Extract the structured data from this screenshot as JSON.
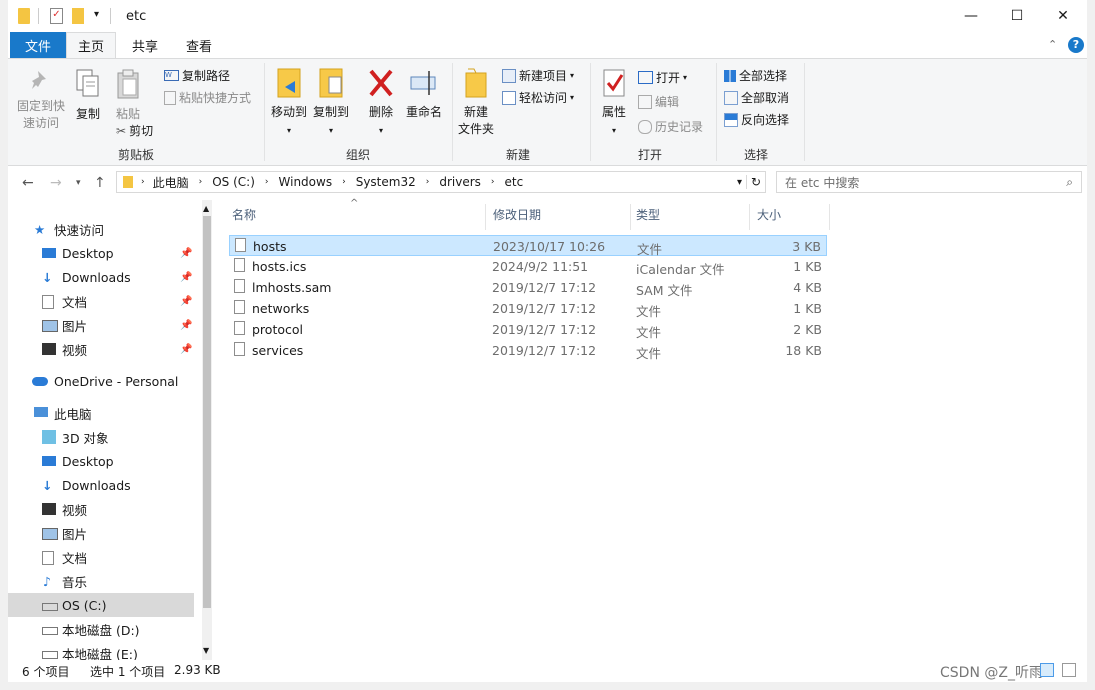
{
  "window": {
    "title": "etc",
    "controls": {
      "minimize": "—",
      "maximize": "☐",
      "close": "✕"
    }
  },
  "ribbon_tabs": [
    "文件",
    "主页",
    "共享",
    "查看"
  ],
  "ribbon": {
    "clipboard": {
      "label": "剪贴板",
      "pin_quick_access": [
        "固定到快",
        "速访问"
      ],
      "copy": "复制",
      "paste": "粘贴",
      "copy_path": "复制路径",
      "paste_shortcut": "粘贴快捷方式",
      "cut": "剪切"
    },
    "organize": {
      "label": "组织",
      "move_to": "移动到",
      "copy_to": "复制到",
      "delete": "删除",
      "rename": "重命名"
    },
    "new": {
      "label": "新建",
      "new_folder": [
        "新建",
        "文件夹"
      ],
      "new_item": "新建项目",
      "easy_access": "轻松访问"
    },
    "open": {
      "label": "打开",
      "properties": "属性",
      "open": "打开",
      "edit": "编辑",
      "history": "历史记录"
    },
    "select": {
      "label": "选择",
      "select_all": "全部选择",
      "select_none": "全部取消",
      "invert": "反向选择"
    }
  },
  "address": {
    "crumbs": [
      "此电脑",
      "OS (C:)",
      "Windows",
      "System32",
      "drivers",
      "etc"
    ],
    "search_placeholder": "在 etc 中搜索"
  },
  "nav": {
    "quick_access": "快速访问",
    "quick_items": [
      "Desktop",
      "Downloads",
      "文档",
      "图片",
      "视频"
    ],
    "onedrive": "OneDrive - Personal",
    "this_pc": "此电脑",
    "pc_items": [
      "3D 对象",
      "Desktop",
      "Downloads",
      "视频",
      "图片",
      "文档",
      "音乐",
      "OS (C:)",
      "本地磁盘 (D:)",
      "本地磁盘 (E:)"
    ]
  },
  "columns": [
    "名称",
    "修改日期",
    "类型",
    "大小"
  ],
  "files": [
    {
      "name": "hosts",
      "date": "2023/10/17 10:26",
      "type": "文件",
      "size": "3 KB"
    },
    {
      "name": "hosts.ics",
      "date": "2024/9/2 11:51",
      "type": "iCalendar 文件",
      "size": "1 KB"
    },
    {
      "name": "lmhosts.sam",
      "date": "2019/12/7 17:12",
      "type": "SAM 文件",
      "size": "4 KB"
    },
    {
      "name": "networks",
      "date": "2019/12/7 17:12",
      "type": "文件",
      "size": "1 KB"
    },
    {
      "name": "protocol",
      "date": "2019/12/7 17:12",
      "type": "文件",
      "size": "2 KB"
    },
    {
      "name": "services",
      "date": "2019/12/7 17:12",
      "type": "文件",
      "size": "18 KB"
    }
  ],
  "status": {
    "item_count": "6 个项目",
    "selected": "选中 1 个项目",
    "selected_size": "2.93 KB"
  },
  "watermark": "CSDN @Z_听雨",
  "colors": {
    "accent": "#1979ca",
    "selection": "#cce8ff"
  }
}
